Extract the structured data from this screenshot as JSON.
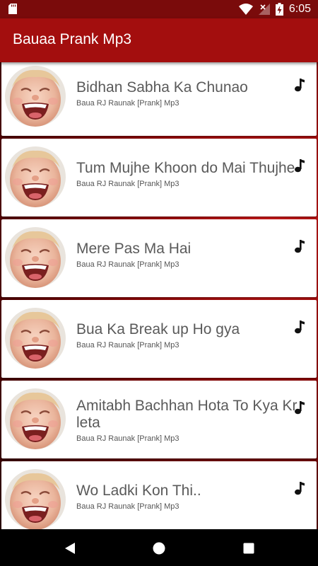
{
  "status_bar": {
    "time": "6:05",
    "icons": [
      "sd-card-icon",
      "wifi-icon",
      "signal-off-icon",
      "battery-charging-icon"
    ]
  },
  "app_bar": {
    "title": "Bauaa Prank Mp3"
  },
  "songs": [
    {
      "title": "Bidhan Sabha Ka Chunao",
      "subtitle": "Baua RJ Raunak [Prank] Mp3"
    },
    {
      "title": "Tum Mujhe Khoon do Mai Thujhe",
      "subtitle": "Baua RJ Raunak [Prank] Mp3"
    },
    {
      "title": "Mere Pas Ma Hai",
      "subtitle": "Baua RJ Raunak [Prank] Mp3"
    },
    {
      "title": "Bua Ka Break up Ho gya",
      "subtitle": "Baua RJ Raunak [Prank] Mp3"
    },
    {
      "title": "Amitabh Bachhan Hota To Kya Kr leta",
      "subtitle": "Baua RJ Raunak [Prank] Mp3"
    },
    {
      "title": "Wo Ladki Kon Thi..",
      "subtitle": "Baua RJ Raunak [Prank] Mp3"
    }
  ],
  "colors": {
    "status_bar": "#7a0b0b",
    "app_bar": "#a30e0e",
    "background_red": "#8e0a0a"
  },
  "nav_bar": {
    "icons": [
      "back-icon",
      "home-icon",
      "recent-apps-icon"
    ]
  }
}
